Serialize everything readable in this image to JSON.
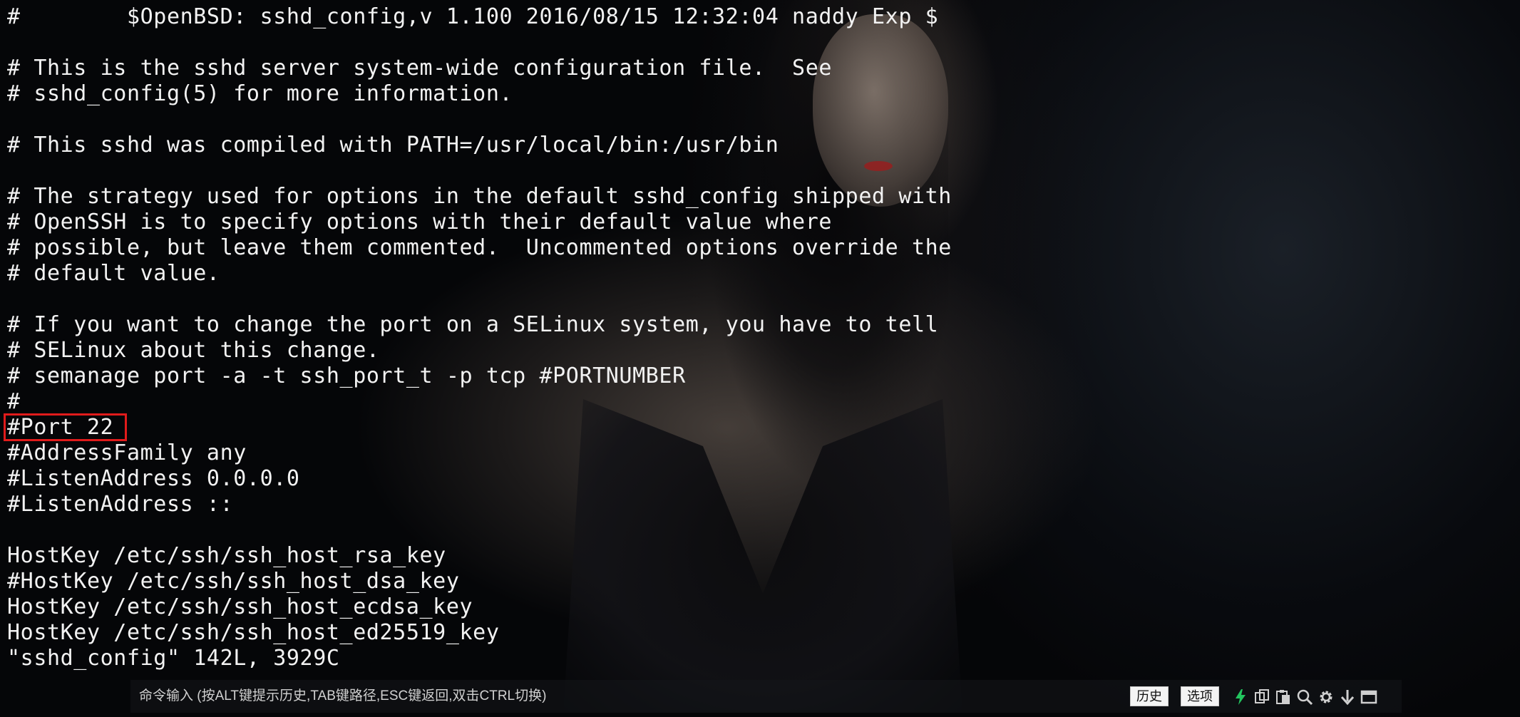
{
  "terminal": {
    "lines": [
      "#\t$OpenBSD: sshd_config,v 1.100 2016/08/15 12:32:04 naddy Exp $",
      "",
      "# This is the sshd server system-wide configuration file.  See",
      "# sshd_config(5) for more information.",
      "",
      "# This sshd was compiled with PATH=/usr/local/bin:/usr/bin",
      "",
      "# The strategy used for options in the default sshd_config shipped with",
      "# OpenSSH is to specify options with their default value where",
      "# possible, but leave them commented.  Uncommented options override the",
      "# default value.",
      "",
      "# If you want to change the port on a SELinux system, you have to tell",
      "# SELinux about this change.",
      "# semanage port -a -t ssh_port_t -p tcp #PORTNUMBER",
      "#",
      "#Port 22",
      "#AddressFamily any",
      "#ListenAddress 0.0.0.0",
      "#ListenAddress ::",
      "",
      "HostKey /etc/ssh/ssh_host_rsa_key",
      "#HostKey /etc/ssh/ssh_host_dsa_key",
      "HostKey /etc/ssh/ssh_host_ecdsa_key",
      "HostKey /etc/ssh/ssh_host_ed25519_key",
      "\"sshd_config\" 142L, 3929C"
    ],
    "highlight_color": "#e11b1b",
    "text_color": "#f2f2f2"
  },
  "command_bar": {
    "placeholder": "命令输入 (按ALT键提示历史,TAB键路径,ESC键返回,双击CTRL切换)",
    "history_label": "历史",
    "options_label": "选项",
    "icons": [
      "lightning-icon",
      "copy-icon",
      "paste-icon",
      "search-icon",
      "gear-icon",
      "download-icon",
      "window-icon"
    ],
    "lightning_color": "#22c55e"
  }
}
